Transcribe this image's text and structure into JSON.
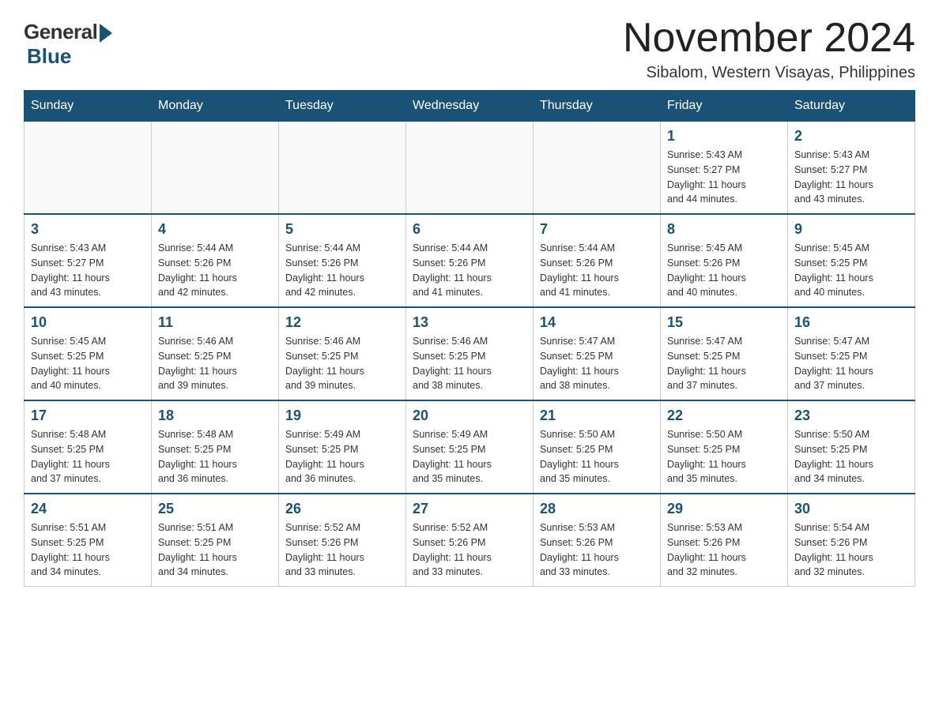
{
  "header": {
    "logo": {
      "general": "General",
      "blue": "Blue"
    },
    "title": "November 2024",
    "location": "Sibalom, Western Visayas, Philippines"
  },
  "weekdays": [
    "Sunday",
    "Monday",
    "Tuesday",
    "Wednesday",
    "Thursday",
    "Friday",
    "Saturday"
  ],
  "weeks": [
    [
      {
        "day": "",
        "info": ""
      },
      {
        "day": "",
        "info": ""
      },
      {
        "day": "",
        "info": ""
      },
      {
        "day": "",
        "info": ""
      },
      {
        "day": "",
        "info": ""
      },
      {
        "day": "1",
        "info": "Sunrise: 5:43 AM\nSunset: 5:27 PM\nDaylight: 11 hours\nand 44 minutes."
      },
      {
        "day": "2",
        "info": "Sunrise: 5:43 AM\nSunset: 5:27 PM\nDaylight: 11 hours\nand 43 minutes."
      }
    ],
    [
      {
        "day": "3",
        "info": "Sunrise: 5:43 AM\nSunset: 5:27 PM\nDaylight: 11 hours\nand 43 minutes."
      },
      {
        "day": "4",
        "info": "Sunrise: 5:44 AM\nSunset: 5:26 PM\nDaylight: 11 hours\nand 42 minutes."
      },
      {
        "day": "5",
        "info": "Sunrise: 5:44 AM\nSunset: 5:26 PM\nDaylight: 11 hours\nand 42 minutes."
      },
      {
        "day": "6",
        "info": "Sunrise: 5:44 AM\nSunset: 5:26 PM\nDaylight: 11 hours\nand 41 minutes."
      },
      {
        "day": "7",
        "info": "Sunrise: 5:44 AM\nSunset: 5:26 PM\nDaylight: 11 hours\nand 41 minutes."
      },
      {
        "day": "8",
        "info": "Sunrise: 5:45 AM\nSunset: 5:26 PM\nDaylight: 11 hours\nand 40 minutes."
      },
      {
        "day": "9",
        "info": "Sunrise: 5:45 AM\nSunset: 5:25 PM\nDaylight: 11 hours\nand 40 minutes."
      }
    ],
    [
      {
        "day": "10",
        "info": "Sunrise: 5:45 AM\nSunset: 5:25 PM\nDaylight: 11 hours\nand 40 minutes."
      },
      {
        "day": "11",
        "info": "Sunrise: 5:46 AM\nSunset: 5:25 PM\nDaylight: 11 hours\nand 39 minutes."
      },
      {
        "day": "12",
        "info": "Sunrise: 5:46 AM\nSunset: 5:25 PM\nDaylight: 11 hours\nand 39 minutes."
      },
      {
        "day": "13",
        "info": "Sunrise: 5:46 AM\nSunset: 5:25 PM\nDaylight: 11 hours\nand 38 minutes."
      },
      {
        "day": "14",
        "info": "Sunrise: 5:47 AM\nSunset: 5:25 PM\nDaylight: 11 hours\nand 38 minutes."
      },
      {
        "day": "15",
        "info": "Sunrise: 5:47 AM\nSunset: 5:25 PM\nDaylight: 11 hours\nand 37 minutes."
      },
      {
        "day": "16",
        "info": "Sunrise: 5:47 AM\nSunset: 5:25 PM\nDaylight: 11 hours\nand 37 minutes."
      }
    ],
    [
      {
        "day": "17",
        "info": "Sunrise: 5:48 AM\nSunset: 5:25 PM\nDaylight: 11 hours\nand 37 minutes."
      },
      {
        "day": "18",
        "info": "Sunrise: 5:48 AM\nSunset: 5:25 PM\nDaylight: 11 hours\nand 36 minutes."
      },
      {
        "day": "19",
        "info": "Sunrise: 5:49 AM\nSunset: 5:25 PM\nDaylight: 11 hours\nand 36 minutes."
      },
      {
        "day": "20",
        "info": "Sunrise: 5:49 AM\nSunset: 5:25 PM\nDaylight: 11 hours\nand 35 minutes."
      },
      {
        "day": "21",
        "info": "Sunrise: 5:50 AM\nSunset: 5:25 PM\nDaylight: 11 hours\nand 35 minutes."
      },
      {
        "day": "22",
        "info": "Sunrise: 5:50 AM\nSunset: 5:25 PM\nDaylight: 11 hours\nand 35 minutes."
      },
      {
        "day": "23",
        "info": "Sunrise: 5:50 AM\nSunset: 5:25 PM\nDaylight: 11 hours\nand 34 minutes."
      }
    ],
    [
      {
        "day": "24",
        "info": "Sunrise: 5:51 AM\nSunset: 5:25 PM\nDaylight: 11 hours\nand 34 minutes."
      },
      {
        "day": "25",
        "info": "Sunrise: 5:51 AM\nSunset: 5:25 PM\nDaylight: 11 hours\nand 34 minutes."
      },
      {
        "day": "26",
        "info": "Sunrise: 5:52 AM\nSunset: 5:26 PM\nDaylight: 11 hours\nand 33 minutes."
      },
      {
        "day": "27",
        "info": "Sunrise: 5:52 AM\nSunset: 5:26 PM\nDaylight: 11 hours\nand 33 minutes."
      },
      {
        "day": "28",
        "info": "Sunrise: 5:53 AM\nSunset: 5:26 PM\nDaylight: 11 hours\nand 33 minutes."
      },
      {
        "day": "29",
        "info": "Sunrise: 5:53 AM\nSunset: 5:26 PM\nDaylight: 11 hours\nand 32 minutes."
      },
      {
        "day": "30",
        "info": "Sunrise: 5:54 AM\nSunset: 5:26 PM\nDaylight: 11 hours\nand 32 minutes."
      }
    ]
  ]
}
